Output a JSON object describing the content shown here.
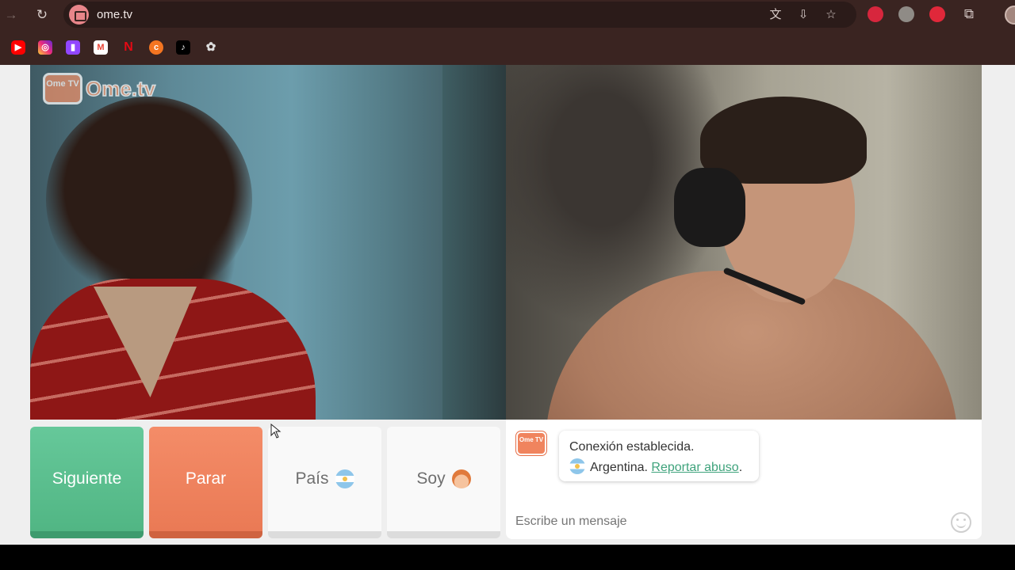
{
  "browser": {
    "url": "ome.tv",
    "bookmarks": [
      "youtube-icon",
      "instagram-icon",
      "twitch-icon",
      "gmail-icon",
      "netflix-icon",
      "crunchyroll-icon",
      "tiktok-icon",
      "chatgpt-icon"
    ],
    "toolbar_icons": [
      "translate-icon",
      "install-app-icon",
      "bookmark-star-icon"
    ],
    "extensions": [
      "record-extension-icon",
      "globe-extension-icon",
      "adblock-extension-icon",
      "puzzle-extensions-icon"
    ]
  },
  "app": {
    "logo_icon_text": "Ome TV",
    "logo_text": "Ome.tv"
  },
  "controls": {
    "next_label": "Siguiente",
    "stop_label": "Parar",
    "country_label": "País",
    "gender_label": "Soy"
  },
  "chat": {
    "message_line1": "Conexión establecida.",
    "country": "Argentina.",
    "report_link": "Reportar abuso",
    "report_suffix": ".",
    "input_placeholder": "Escribe un mensaje"
  },
  "colors": {
    "next": "#51b684",
    "stop": "#ea7a55",
    "accent": "#f0845e",
    "link": "#3fa37c"
  }
}
